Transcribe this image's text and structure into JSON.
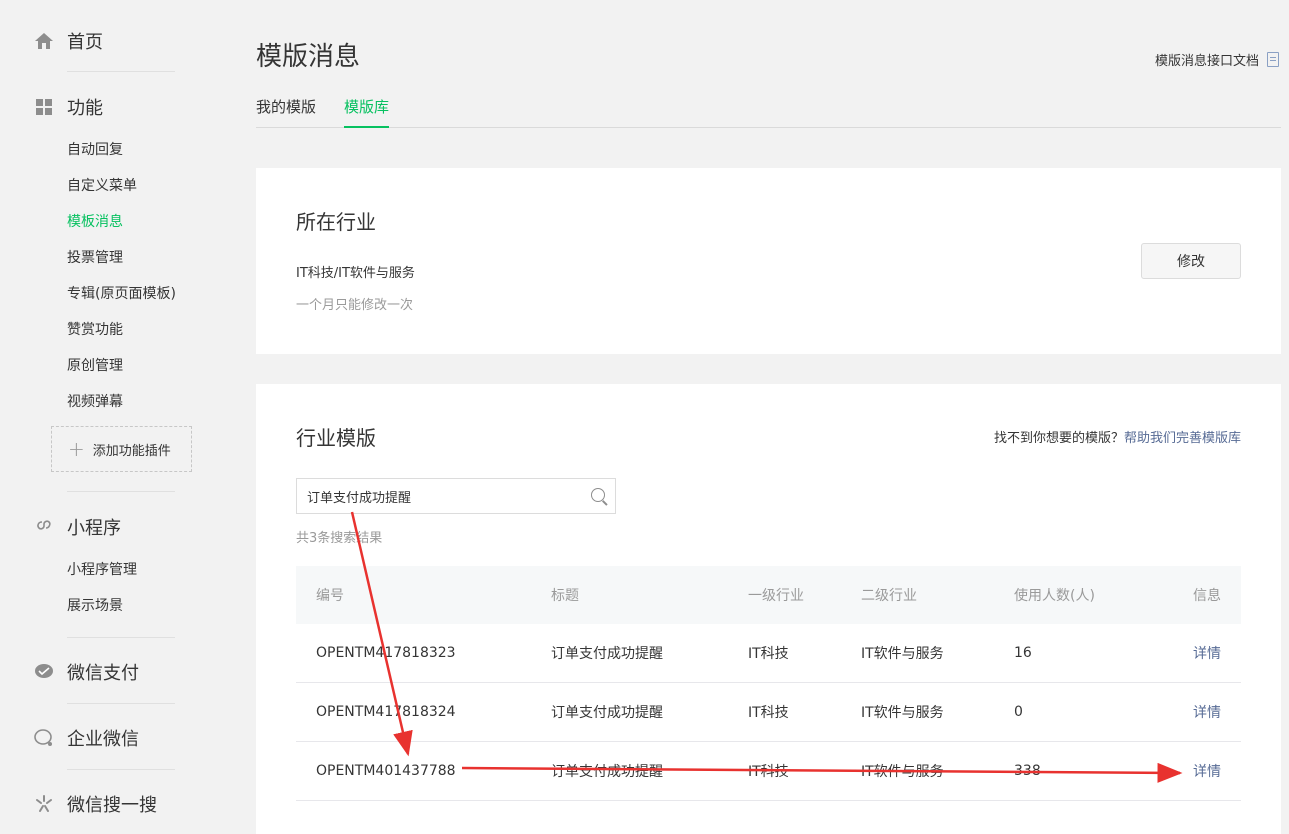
{
  "sidebar": {
    "home": "首页",
    "features": {
      "title": "功能",
      "items": [
        "自动回复",
        "自定义菜单",
        "模板消息",
        "投票管理",
        "专辑(原页面模板)",
        "赞赏功能",
        "原创管理",
        "视频弹幕"
      ],
      "active_index": 2,
      "add_plugin": "添加功能插件"
    },
    "miniprogram": {
      "title": "小程序",
      "items": [
        "小程序管理",
        "展示场景"
      ]
    },
    "wechat_pay": "微信支付",
    "work_wechat": "企业微信",
    "wechat_search": "微信搜一搜"
  },
  "header": {
    "title": "模版消息",
    "doc_link": "模版消息接口文档"
  },
  "tabs": [
    {
      "label": "我的模版",
      "active": false
    },
    {
      "label": "模版库",
      "active": true
    }
  ],
  "industry": {
    "title": "所在行业",
    "value": "IT科技/IT软件与服务",
    "note": "一个月只能修改一次",
    "modify_button": "修改"
  },
  "templates": {
    "title": "行业模版",
    "help_prefix": "找不到你想要的模版？",
    "help_link": "帮助我们完善模版库",
    "search_value": "订单支付成功提醒",
    "result_count": "共3条搜索结果",
    "columns": [
      "编号",
      "标题",
      "一级行业",
      "二级行业",
      "使用人数(人)",
      "信息"
    ],
    "rows": [
      {
        "id": "OPENTM417818323",
        "title": "订单支付成功提醒",
        "industry1": "IT科技",
        "industry2": "IT软件与服务",
        "users": "16",
        "info": "详情"
      },
      {
        "id": "OPENTM417818324",
        "title": "订单支付成功提醒",
        "industry1": "IT科技",
        "industry2": "IT软件与服务",
        "users": "0",
        "info": "详情"
      },
      {
        "id": "OPENTM401437788",
        "title": "订单支付成功提醒",
        "industry1": "IT科技",
        "industry2": "IT软件与服务",
        "users": "338",
        "info": "详情"
      }
    ]
  },
  "colors": {
    "accent": "#07c160",
    "link": "#576b95",
    "annotation_arrow": "#e8322f"
  }
}
